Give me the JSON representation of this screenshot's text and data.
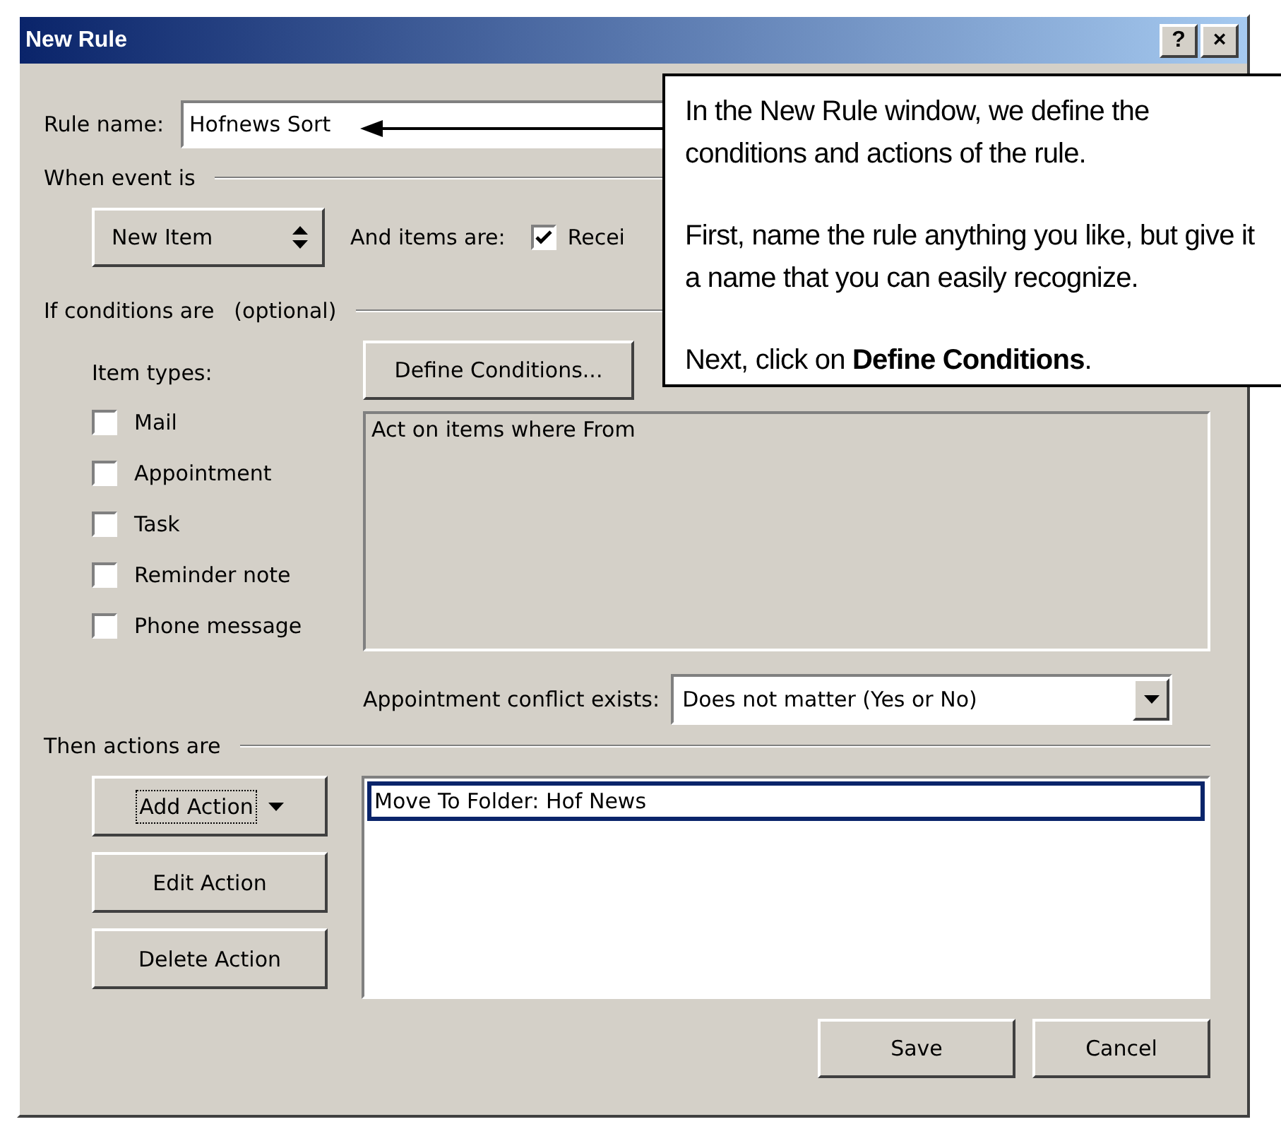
{
  "window": {
    "title": "New Rule",
    "buttons": [
      "?",
      "×"
    ]
  },
  "rule_name": {
    "label": "Rule name:",
    "value": "Hofnews Sort"
  },
  "event": {
    "heading": "When event is",
    "dropdown": "New Item",
    "items_label": "And items are:",
    "items_checkbox": {
      "label": "Recei",
      "checked": true
    }
  },
  "conditions": {
    "heading": "If conditions are",
    "note": "(optional)",
    "item_types_label": "Item types:",
    "item_types": [
      {
        "label": "Mail",
        "checked": false
      },
      {
        "label": "Appointment",
        "checked": false
      },
      {
        "label": "Task",
        "checked": false
      },
      {
        "label": "Reminder note",
        "checked": false
      },
      {
        "label": "Phone message",
        "checked": false
      }
    ],
    "define_button": "Define Conditions...",
    "description": "Act on items where From",
    "conflict": {
      "label": "Appointment conflict exists:",
      "value": "Does not matter (Yes or No)"
    }
  },
  "actions": {
    "heading": "Then actions are",
    "buttons": [
      {
        "label": "Add Action",
        "kind": "split",
        "focused": true
      },
      {
        "label": "Edit Action",
        "kind": "plain",
        "focused": false
      },
      {
        "label": "Delete Action",
        "kind": "plain",
        "focused": false
      }
    ],
    "list": [
      {
        "text": "Move To Folder: Hof News",
        "selected": true
      }
    ]
  },
  "footer_buttons": [
    "Save",
    "Cancel"
  ],
  "callout": {
    "paragraphs": [
      "In the New Rule window, we define the conditions and actions of the rule.",
      "First, name the rule anything you like, but give it a name that you can easily recognize.",
      "Next, click on **Define Conditions**."
    ]
  }
}
